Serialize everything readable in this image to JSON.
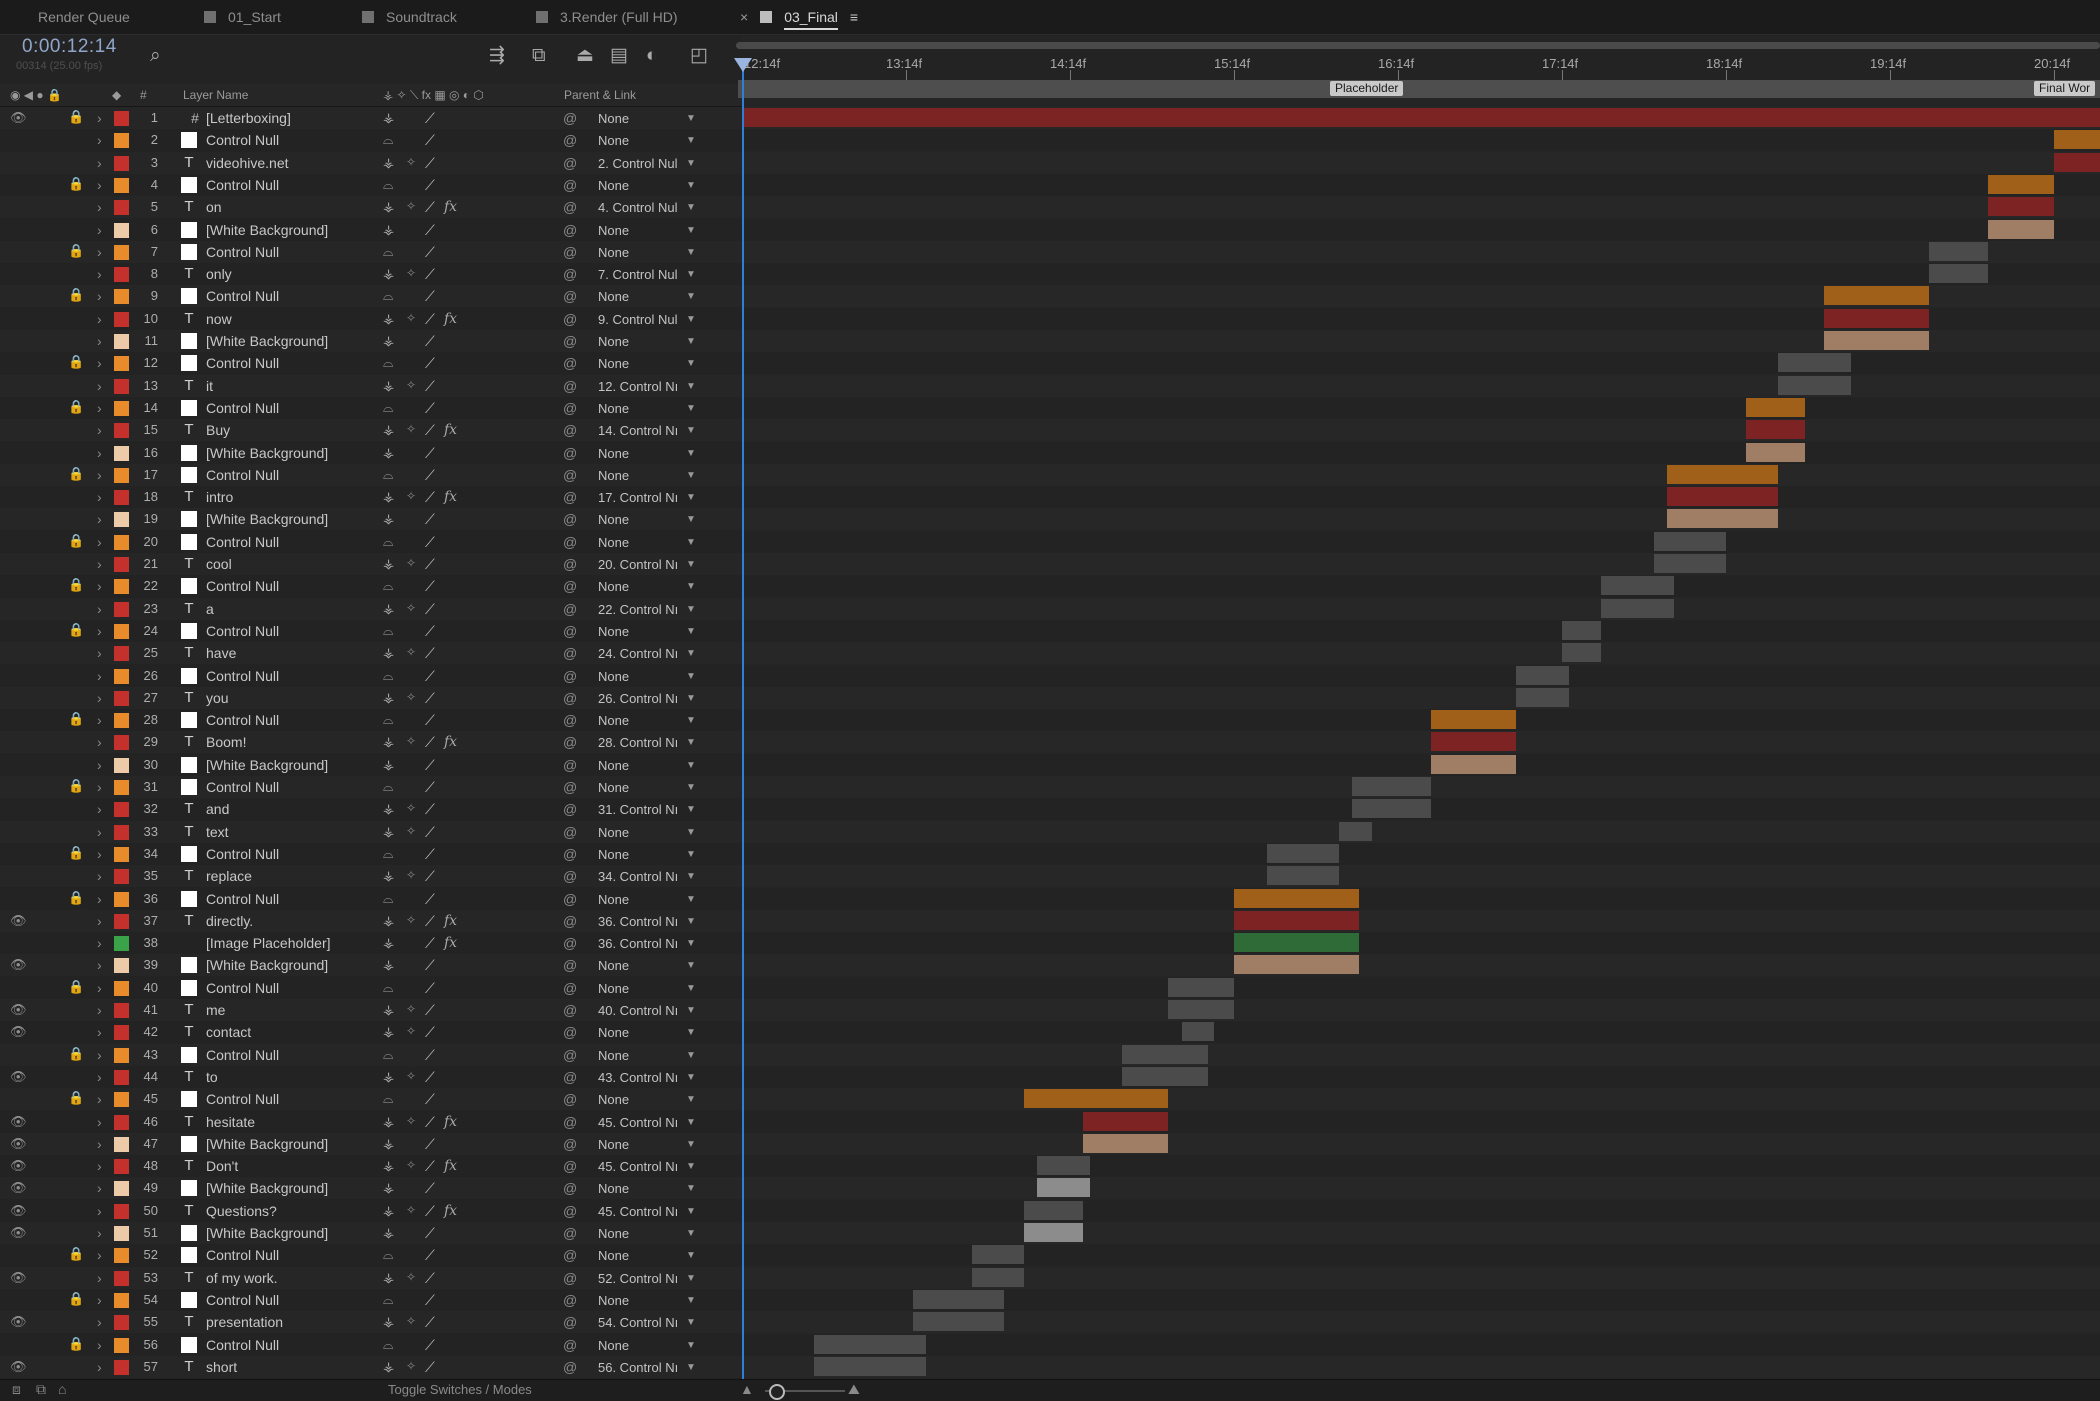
{
  "tabs": [
    {
      "label": "Render Queue",
      "active": false
    },
    {
      "label": "01_Start",
      "active": false
    },
    {
      "label": "Soundtrack",
      "active": false
    },
    {
      "label": "3.Render (Full HD)",
      "active": false
    },
    {
      "label": "03_Final",
      "active": true
    }
  ],
  "timecode": "0:00:12:14",
  "timecode_sub": "00314 (25.00 fps)",
  "columns": {
    "layer_name": "Layer Name",
    "parent_link": "Parent & Link",
    "num": "#"
  },
  "ruler_labels": [
    "12:14f",
    "13:14f",
    "14:14f",
    "15:14f",
    "16:14f",
    "17:14f",
    "18:14f",
    "19:14f",
    "20:14f"
  ],
  "markers": [
    {
      "label": "Placeholder"
    },
    {
      "label": "Final Wor"
    }
  ],
  "bottom": {
    "toggle_label": "Toggle Switches / Modes"
  },
  "colors": {
    "orange": "#e88b2a",
    "red": "#c4302b",
    "peach": "#eecba8",
    "green": "#3aa34a",
    "bar_orange": "#a1601a",
    "bar_red": "#7e2323",
    "bar_peach": "#a07e66",
    "bar_green": "#2f6b36",
    "bar_gray": "#4b4b4b",
    "bar_lightgray": "#8c8c8c",
    "bar_letterbox": "#7c2323"
  },
  "layers": [
    {
      "n": "1",
      "name": "[Letterboxing]",
      "type": "hash",
      "color": "red",
      "eye": true,
      "lock": true,
      "fx": false,
      "parent": "None"
    },
    {
      "n": "2",
      "name": "Control Null",
      "type": "solid",
      "color": "orange",
      "eye": false,
      "lock": false,
      "fx": false,
      "parent": "None"
    },
    {
      "n": "3",
      "name": "videohive.net",
      "type": "text",
      "color": "red",
      "eye": false,
      "lock": false,
      "fx": false,
      "parent": "2. Control Nul"
    },
    {
      "n": "4",
      "name": "Control Null",
      "type": "solid",
      "color": "orange",
      "eye": false,
      "lock": true,
      "fx": false,
      "parent": "None"
    },
    {
      "n": "5",
      "name": "on",
      "type": "text",
      "color": "red",
      "eye": false,
      "lock": false,
      "fx": true,
      "parent": "4. Control Nul"
    },
    {
      "n": "6",
      "name": "[White Background]",
      "type": "solid",
      "color": "peach",
      "eye": false,
      "lock": false,
      "fx": false,
      "parent": "None"
    },
    {
      "n": "7",
      "name": "Control Null",
      "type": "solid",
      "color": "orange",
      "eye": false,
      "lock": true,
      "fx": false,
      "parent": "None"
    },
    {
      "n": "8",
      "name": "only",
      "type": "text",
      "color": "red",
      "eye": false,
      "lock": false,
      "fx": false,
      "parent": "7. Control Nul"
    },
    {
      "n": "9",
      "name": "Control Null",
      "type": "solid",
      "color": "orange",
      "eye": false,
      "lock": true,
      "fx": false,
      "parent": "None"
    },
    {
      "n": "10",
      "name": "now",
      "type": "text",
      "color": "red",
      "eye": false,
      "lock": false,
      "fx": true,
      "parent": "9. Control Nul"
    },
    {
      "n": "11",
      "name": "[White Background]",
      "type": "solid",
      "color": "peach",
      "eye": false,
      "lock": false,
      "fx": false,
      "parent": "None"
    },
    {
      "n": "12",
      "name": "Control Null",
      "type": "solid",
      "color": "orange",
      "eye": false,
      "lock": true,
      "fx": false,
      "parent": "None"
    },
    {
      "n": "13",
      "name": "it",
      "type": "text",
      "color": "red",
      "eye": false,
      "lock": false,
      "fx": false,
      "parent": "12. Control Nı"
    },
    {
      "n": "14",
      "name": "Control Null",
      "type": "solid",
      "color": "orange",
      "eye": false,
      "lock": true,
      "fx": false,
      "parent": "None"
    },
    {
      "n": "15",
      "name": "Buy",
      "type": "text",
      "color": "red",
      "eye": false,
      "lock": false,
      "fx": true,
      "parent": "14. Control Nı"
    },
    {
      "n": "16",
      "name": "[White Background]",
      "type": "solid",
      "color": "peach",
      "eye": false,
      "lock": false,
      "fx": false,
      "parent": "None"
    },
    {
      "n": "17",
      "name": "Control Null",
      "type": "solid",
      "color": "orange",
      "eye": false,
      "lock": true,
      "fx": false,
      "parent": "None"
    },
    {
      "n": "18",
      "name": "intro",
      "type": "text",
      "color": "red",
      "eye": false,
      "lock": false,
      "fx": true,
      "parent": "17. Control Nı"
    },
    {
      "n": "19",
      "name": "[White Background]",
      "type": "solid",
      "color": "peach",
      "eye": false,
      "lock": false,
      "fx": false,
      "parent": "None"
    },
    {
      "n": "20",
      "name": "Control Null",
      "type": "solid",
      "color": "orange",
      "eye": false,
      "lock": true,
      "fx": false,
      "parent": "None"
    },
    {
      "n": "21",
      "name": "cool",
      "type": "text",
      "color": "red",
      "eye": false,
      "lock": false,
      "fx": false,
      "parent": "20. Control Nı"
    },
    {
      "n": "22",
      "name": "Control Null",
      "type": "solid",
      "color": "orange",
      "eye": false,
      "lock": true,
      "fx": false,
      "parent": "None"
    },
    {
      "n": "23",
      "name": "a",
      "type": "text",
      "color": "red",
      "eye": false,
      "lock": false,
      "fx": false,
      "parent": "22. Control Nı"
    },
    {
      "n": "24",
      "name": "Control Null",
      "type": "solid",
      "color": "orange",
      "eye": false,
      "lock": true,
      "fx": false,
      "parent": "None"
    },
    {
      "n": "25",
      "name": "have",
      "type": "text",
      "color": "red",
      "eye": false,
      "lock": false,
      "fx": false,
      "parent": "24. Control Nı"
    },
    {
      "n": "26",
      "name": "Control Null",
      "type": "solid",
      "color": "orange",
      "eye": false,
      "lock": false,
      "fx": false,
      "parent": "None"
    },
    {
      "n": "27",
      "name": "you",
      "type": "text",
      "color": "red",
      "eye": false,
      "lock": false,
      "fx": false,
      "parent": "26. Control Nı"
    },
    {
      "n": "28",
      "name": "Control Null",
      "type": "solid",
      "color": "orange",
      "eye": false,
      "lock": true,
      "fx": false,
      "parent": "None"
    },
    {
      "n": "29",
      "name": "Boom!",
      "type": "text",
      "color": "red",
      "eye": false,
      "lock": false,
      "fx": true,
      "parent": "28. Control Nı"
    },
    {
      "n": "30",
      "name": "[White Background]",
      "type": "solid",
      "color": "peach",
      "eye": false,
      "lock": false,
      "fx": false,
      "parent": "None"
    },
    {
      "n": "31",
      "name": "Control Null",
      "type": "solid",
      "color": "orange",
      "eye": false,
      "lock": true,
      "fx": false,
      "parent": "None"
    },
    {
      "n": "32",
      "name": "and",
      "type": "text",
      "color": "red",
      "eye": false,
      "lock": false,
      "fx": false,
      "parent": "31. Control Nı"
    },
    {
      "n": "33",
      "name": "text",
      "type": "text",
      "color": "red",
      "eye": false,
      "lock": false,
      "fx": false,
      "parent": "None"
    },
    {
      "n": "34",
      "name": "Control Null",
      "type": "solid",
      "color": "orange",
      "eye": false,
      "lock": true,
      "fx": false,
      "parent": "None"
    },
    {
      "n": "35",
      "name": "replace",
      "type": "text",
      "color": "red",
      "eye": false,
      "lock": false,
      "fx": false,
      "parent": "34. Control Nı"
    },
    {
      "n": "36",
      "name": "Control Null",
      "type": "solid",
      "color": "orange",
      "eye": false,
      "lock": true,
      "fx": false,
      "parent": "None"
    },
    {
      "n": "37",
      "name": "directly.",
      "type": "text",
      "color": "red",
      "eye": true,
      "lock": false,
      "fx": true,
      "parent": "36. Control Nı"
    },
    {
      "n": "38",
      "name": "[Image Placeholder]",
      "type": "none",
      "color": "green",
      "eye": false,
      "lock": false,
      "fx": true,
      "parent": "36. Control Nı"
    },
    {
      "n": "39",
      "name": "[White Background]",
      "type": "solid",
      "color": "peach",
      "eye": true,
      "lock": false,
      "fx": false,
      "parent": "None"
    },
    {
      "n": "40",
      "name": "Control Null",
      "type": "solid",
      "color": "orange",
      "eye": false,
      "lock": true,
      "fx": false,
      "parent": "None"
    },
    {
      "n": "41",
      "name": "me",
      "type": "text",
      "color": "red",
      "eye": true,
      "lock": false,
      "fx": false,
      "parent": "40. Control Nı"
    },
    {
      "n": "42",
      "name": "contact",
      "type": "text",
      "color": "red",
      "eye": true,
      "lock": false,
      "fx": false,
      "parent": "None"
    },
    {
      "n": "43",
      "name": "Control Null",
      "type": "solid",
      "color": "orange",
      "eye": false,
      "lock": true,
      "fx": false,
      "parent": "None"
    },
    {
      "n": "44",
      "name": "to",
      "type": "text",
      "color": "red",
      "eye": true,
      "lock": false,
      "fx": false,
      "parent": "43. Control Nı"
    },
    {
      "n": "45",
      "name": "Control Null",
      "type": "solid",
      "color": "orange",
      "eye": false,
      "lock": true,
      "fx": false,
      "parent": "None"
    },
    {
      "n": "46",
      "name": "hesitate",
      "type": "text",
      "color": "red",
      "eye": true,
      "lock": false,
      "fx": true,
      "parent": "45. Control Nı"
    },
    {
      "n": "47",
      "name": "[White Background]",
      "type": "solid",
      "color": "peach",
      "eye": true,
      "lock": false,
      "fx": false,
      "parent": "None"
    },
    {
      "n": "48",
      "name": "Don't",
      "type": "text",
      "color": "red",
      "eye": true,
      "lock": false,
      "fx": true,
      "parent": "45. Control Nı"
    },
    {
      "n": "49",
      "name": "[White Background]",
      "type": "solid",
      "color": "peach",
      "eye": true,
      "lock": false,
      "fx": false,
      "parent": "None"
    },
    {
      "n": "50",
      "name": "Questions?",
      "type": "text",
      "color": "red",
      "eye": true,
      "lock": false,
      "fx": true,
      "parent": "45. Control Nı"
    },
    {
      "n": "51",
      "name": "[White Background]",
      "type": "solid",
      "color": "peach",
      "eye": true,
      "lock": false,
      "fx": false,
      "parent": "None"
    },
    {
      "n": "52",
      "name": "Control Null",
      "type": "solid",
      "color": "orange",
      "eye": false,
      "lock": true,
      "fx": false,
      "parent": "None"
    },
    {
      "n": "53",
      "name": "of my work.",
      "type": "text",
      "color": "red",
      "eye": true,
      "lock": false,
      "fx": false,
      "parent": "52. Control Nı"
    },
    {
      "n": "54",
      "name": "Control Null",
      "type": "solid",
      "color": "orange",
      "eye": false,
      "lock": true,
      "fx": false,
      "parent": "None"
    },
    {
      "n": "55",
      "name": "presentation",
      "type": "text",
      "color": "red",
      "eye": true,
      "lock": false,
      "fx": false,
      "parent": "54. Control Nı"
    },
    {
      "n": "56",
      "name": "Control Null",
      "type": "solid",
      "color": "orange",
      "eye": false,
      "lock": true,
      "fx": false,
      "parent": "None"
    },
    {
      "n": "57",
      "name": "short",
      "type": "text",
      "color": "red",
      "eye": true,
      "lock": false,
      "fx": false,
      "parent": "56. Control Nı"
    }
  ],
  "track_bars": [
    {
      "row": 0,
      "start": "12:14",
      "end": "21:00",
      "color": "bar_letterbox"
    },
    {
      "row": 1,
      "start": "20:14",
      "end": "21:00",
      "color": "bar_orange"
    },
    {
      "row": 2,
      "start": "20:14",
      "end": "21:00",
      "color": "bar_red"
    },
    {
      "row": 3,
      "start": "20:04",
      "end": "20:14",
      "color": "bar_orange"
    },
    {
      "row": 4,
      "start": "20:04",
      "end": "20:14",
      "color": "bar_red"
    },
    {
      "row": 5,
      "start": "20:04",
      "end": "20:14",
      "color": "bar_peach"
    },
    {
      "row": 6,
      "start": "19:20",
      "end": "20:04",
      "color": "bar_gray"
    },
    {
      "row": 7,
      "start": "19:20",
      "end": "20:04",
      "color": "bar_gray"
    },
    {
      "row": 8,
      "start": "19:04",
      "end": "19:20",
      "color": "bar_orange"
    },
    {
      "row": 9,
      "start": "19:04",
      "end": "19:20",
      "color": "bar_red"
    },
    {
      "row": 10,
      "start": "19:04",
      "end": "19:20",
      "color": "bar_peach"
    },
    {
      "row": 11,
      "start": "18:22",
      "end": "19:08",
      "color": "bar_gray"
    },
    {
      "row": 12,
      "start": "18:22",
      "end": "19:08",
      "color": "bar_gray"
    },
    {
      "row": 13,
      "start": "18:17",
      "end": "19:01",
      "color": "bar_orange"
    },
    {
      "row": 14,
      "start": "18:17",
      "end": "19:01",
      "color": "bar_red"
    },
    {
      "row": 15,
      "start": "18:17",
      "end": "19:01",
      "color": "bar_peach"
    },
    {
      "row": 16,
      "start": "18:05",
      "end": "18:22",
      "color": "bar_orange"
    },
    {
      "row": 17,
      "start": "18:05",
      "end": "18:22",
      "color": "bar_red"
    },
    {
      "row": 18,
      "start": "18:05",
      "end": "18:22",
      "color": "bar_peach"
    },
    {
      "row": 19,
      "start": "18:03",
      "end": "18:14",
      "color": "bar_gray"
    },
    {
      "row": 20,
      "start": "18:03",
      "end": "18:14",
      "color": "bar_gray"
    },
    {
      "row": 21,
      "start": "17:20",
      "end": "18:06",
      "color": "bar_gray"
    },
    {
      "row": 22,
      "start": "17:20",
      "end": "18:06",
      "color": "bar_gray"
    },
    {
      "row": 23,
      "start": "17:14",
      "end": "17:20",
      "color": "bar_gray"
    },
    {
      "row": 24,
      "start": "17:14",
      "end": "17:20",
      "color": "bar_gray"
    },
    {
      "row": 25,
      "start": "17:07",
      "end": "17:15",
      "color": "bar_gray"
    },
    {
      "row": 26,
      "start": "17:07",
      "end": "17:15",
      "color": "bar_gray"
    },
    {
      "row": 27,
      "start": "16:19",
      "end": "17:07",
      "color": "bar_orange"
    },
    {
      "row": 28,
      "start": "16:19",
      "end": "17:07",
      "color": "bar_red"
    },
    {
      "row": 29,
      "start": "16:19",
      "end": "17:07",
      "color": "bar_peach"
    },
    {
      "row": 30,
      "start": "16:07",
      "end": "16:19",
      "color": "bar_gray"
    },
    {
      "row": 31,
      "start": "16:07",
      "end": "16:19",
      "color": "bar_gray"
    },
    {
      "row": 32,
      "start": "16:05",
      "end": "16:10",
      "color": "bar_gray"
    },
    {
      "row": 33,
      "start": "15:19",
      "end": "16:05",
      "color": "bar_gray"
    },
    {
      "row": 34,
      "start": "15:19",
      "end": "16:05",
      "color": "bar_gray"
    },
    {
      "row": 35,
      "start": "15:14",
      "end": "16:08",
      "color": "bar_orange"
    },
    {
      "row": 36,
      "start": "15:14",
      "end": "16:08",
      "color": "bar_red"
    },
    {
      "row": 37,
      "start": "15:14",
      "end": "16:08",
      "color": "bar_green"
    },
    {
      "row": 38,
      "start": "15:14",
      "end": "16:08",
      "color": "bar_peach"
    },
    {
      "row": 39,
      "start": "15:04",
      "end": "15:14",
      "color": "bar_gray"
    },
    {
      "row": 40,
      "start": "15:04",
      "end": "15:14",
      "color": "bar_gray"
    },
    {
      "row": 41,
      "start": "15:06",
      "end": "15:11",
      "color": "bar_gray"
    },
    {
      "row": 42,
      "start": "14:22",
      "end": "15:10",
      "color": "bar_gray"
    },
    {
      "row": 43,
      "start": "14:22",
      "end": "15:10",
      "color": "bar_gray"
    },
    {
      "row": 44,
      "start": "14:07",
      "end": "15:04",
      "color": "bar_orange"
    },
    {
      "row": 45,
      "start": "14:16",
      "end": "15:04",
      "color": "bar_red"
    },
    {
      "row": 46,
      "start": "14:16",
      "end": "15:04",
      "color": "bar_peach"
    },
    {
      "row": 47,
      "start": "14:09",
      "end": "14:17",
      "color": "bar_gray"
    },
    {
      "row": 48,
      "start": "14:09",
      "end": "14:17",
      "color": "bar_lightgray"
    },
    {
      "row": 49,
      "start": "14:07",
      "end": "14:16",
      "color": "bar_gray"
    },
    {
      "row": 50,
      "start": "14:07",
      "end": "14:16",
      "color": "bar_lightgray"
    },
    {
      "row": 51,
      "start": "13:24",
      "end": "14:07",
      "color": "bar_gray"
    },
    {
      "row": 52,
      "start": "13:24",
      "end": "14:07",
      "color": "bar_gray"
    },
    {
      "row": 53,
      "start": "13:15",
      "end": "14:04",
      "color": "bar_gray"
    },
    {
      "row": 54,
      "start": "13:15",
      "end": "14:04",
      "color": "bar_gray"
    },
    {
      "row": 55,
      "start": "13:00",
      "end": "13:17",
      "color": "bar_gray"
    },
    {
      "row": 56,
      "start": "13:00",
      "end": "13:17",
      "color": "bar_gray"
    }
  ]
}
